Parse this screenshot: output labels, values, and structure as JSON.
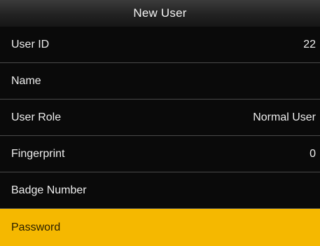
{
  "header": {
    "title": "New User"
  },
  "menu": {
    "items": [
      {
        "label": "User ID",
        "value": "22"
      },
      {
        "label": "Name",
        "value": ""
      },
      {
        "label": "User Role",
        "value": "Normal User"
      },
      {
        "label": "Fingerprint",
        "value": "0"
      },
      {
        "label": "Badge Number",
        "value": ""
      },
      {
        "label": "Password",
        "value": ""
      }
    ],
    "selected_index": 5
  },
  "colors": {
    "background": "#050505",
    "highlight": "#f5b800",
    "divider": "#4a4a4a"
  }
}
